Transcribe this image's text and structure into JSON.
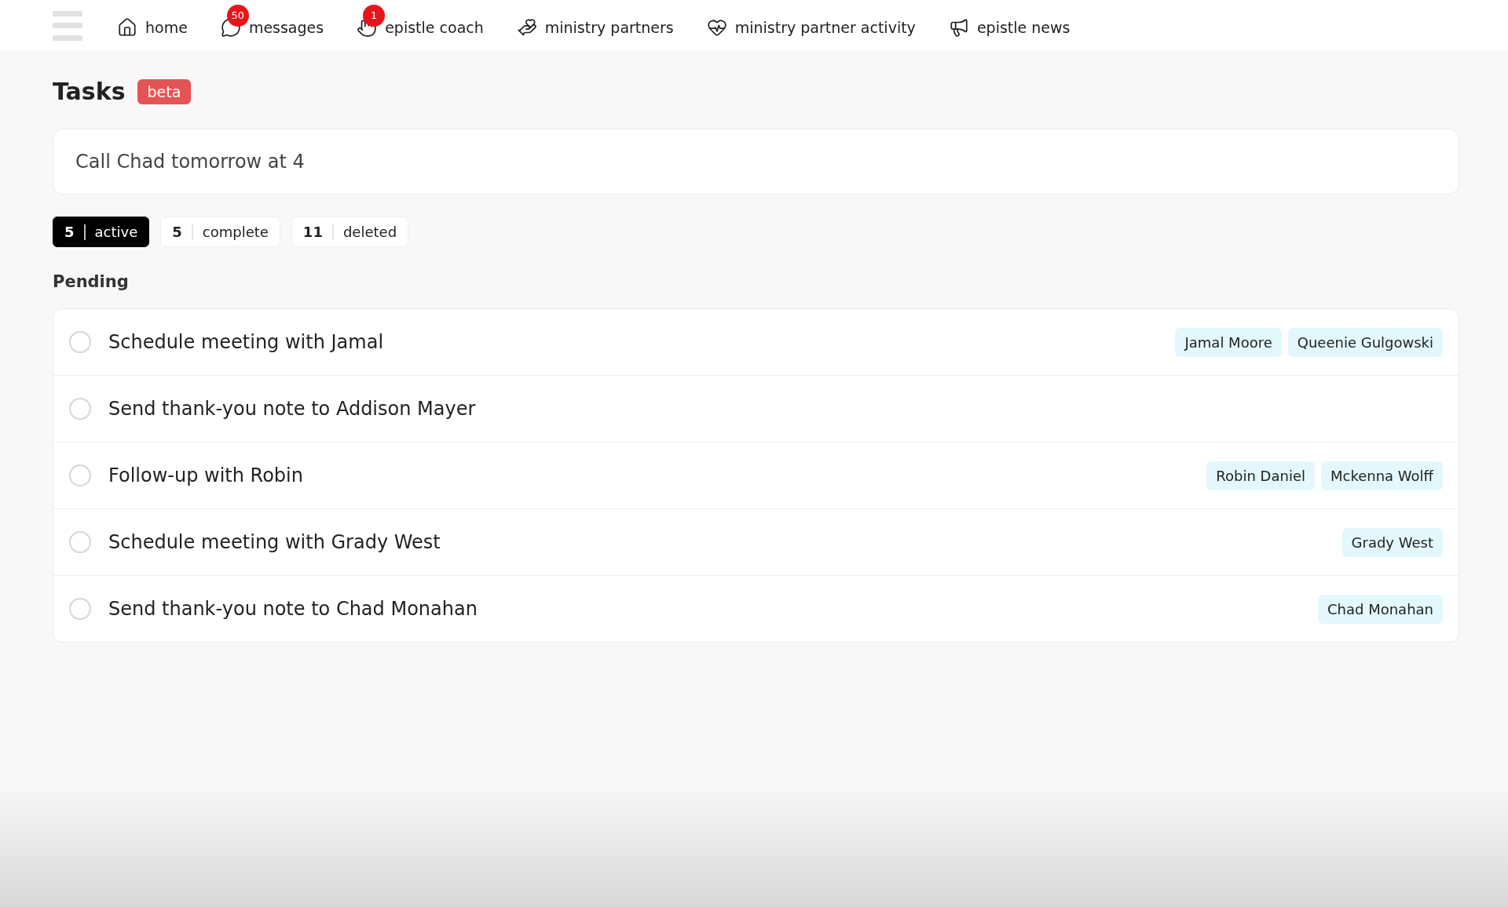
{
  "nav": [
    {
      "label": "home"
    },
    {
      "label": "messages",
      "badge": "50"
    },
    {
      "label": "epistle coach",
      "badge": "1"
    },
    {
      "label": "ministry partners"
    },
    {
      "label": "ministry partner activity"
    },
    {
      "label": "epistle news"
    }
  ],
  "page": {
    "title": "Tasks",
    "badge": "beta"
  },
  "task_input": {
    "value": "Call Chad tomorrow at 4"
  },
  "filters": [
    {
      "count": "5",
      "label": "active",
      "selected": true
    },
    {
      "count": "5",
      "label": "complete",
      "selected": false
    },
    {
      "count": "11",
      "label": "deleted",
      "selected": false
    }
  ],
  "section": "Pending",
  "tasks": [
    {
      "title": "Schedule meeting with Jamal",
      "checked": false,
      "tags": [
        "Jamal Moore",
        "Queenie Gulgowski"
      ]
    },
    {
      "title": "Send thank-you note to Addison Mayer",
      "checked": false
    },
    {
      "title": "Follow-up with Robin",
      "checked": false,
      "tags": [
        "Robin Daniel",
        "Mckenna Wolff"
      ]
    },
    {
      "title": "Schedule meeting with Grady West",
      "checked": false,
      "tags": [
        "Grady West"
      ]
    },
    {
      "title": "Send thank-you note to Chad Monahan",
      "checked": false,
      "tags": [
        "Chad Monahan"
      ]
    }
  ]
}
